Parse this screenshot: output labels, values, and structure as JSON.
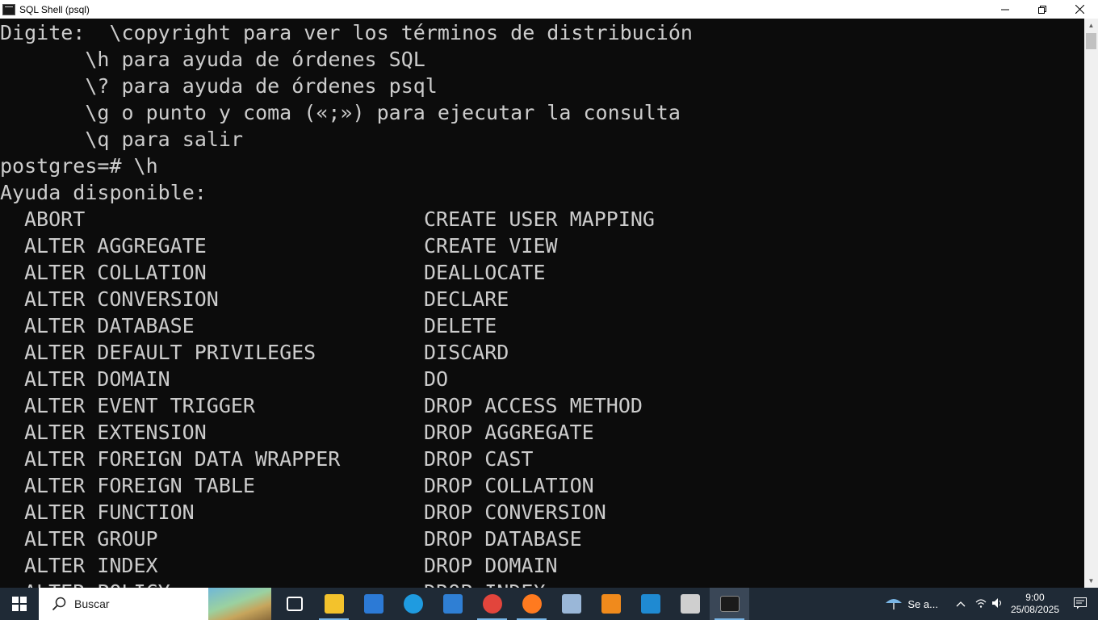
{
  "window": {
    "title": "SQL Shell (psql)",
    "controls": {
      "minimize": "—",
      "restore": "❐",
      "close": "✕"
    }
  },
  "terminal": {
    "lines": [
      "Digite:  \\copyright para ver los términos de distribución",
      "       \\h para ayuda de órdenes SQL",
      "       \\? para ayuda de órdenes psql",
      "       \\g o punto y coma («;») para ejecutar la consulta",
      "       \\q para salir",
      "postgres=# \\h",
      "Ayuda disponible:"
    ],
    "help_rows": [
      [
        "ABORT",
        "CREATE USER MAPPING"
      ],
      [
        "ALTER AGGREGATE",
        "CREATE VIEW"
      ],
      [
        "ALTER COLLATION",
        "DEALLOCATE"
      ],
      [
        "ALTER CONVERSION",
        "DECLARE"
      ],
      [
        "ALTER DATABASE",
        "DELETE"
      ],
      [
        "ALTER DEFAULT PRIVILEGES",
        "DISCARD"
      ],
      [
        "ALTER DOMAIN",
        "DO"
      ],
      [
        "ALTER EVENT TRIGGER",
        "DROP ACCESS METHOD"
      ],
      [
        "ALTER EXTENSION",
        "DROP AGGREGATE"
      ],
      [
        "ALTER FOREIGN DATA WRAPPER",
        "DROP CAST"
      ],
      [
        "ALTER FOREIGN TABLE",
        "DROP COLLATION"
      ],
      [
        "ALTER FUNCTION",
        "DROP CONVERSION"
      ],
      [
        "ALTER GROUP",
        "DROP DATABASE"
      ],
      [
        "ALTER INDEX",
        "DROP DOMAIN"
      ],
      [
        "ALTER POLICY",
        "DROP INDEX"
      ]
    ]
  },
  "taskbar": {
    "search_placeholder": "Buscar",
    "apps": [
      {
        "name": "task-view",
        "color": "#ffffff"
      },
      {
        "name": "file-explorer",
        "color": "#f3c22c"
      },
      {
        "name": "microsoft-store",
        "color": "#2c7ad6"
      },
      {
        "name": "edge",
        "color": "#1f9be0"
      },
      {
        "name": "mail",
        "color": "#2f7fd4"
      },
      {
        "name": "chrome",
        "color": "#e2453c"
      },
      {
        "name": "firefox",
        "color": "#ff7a1f"
      },
      {
        "name": "virtualbox",
        "color": "#9ab7d8"
      },
      {
        "name": "sublime-text",
        "color": "#f08a1c"
      },
      {
        "name": "vscode",
        "color": "#1f8ad2"
      },
      {
        "name": "paint",
        "color": "#cfcfcf"
      },
      {
        "name": "terminal",
        "color": "#1b1b1b"
      }
    ],
    "weather_text": "Se a...",
    "time": "9:00",
    "date": "25/08/2025"
  }
}
